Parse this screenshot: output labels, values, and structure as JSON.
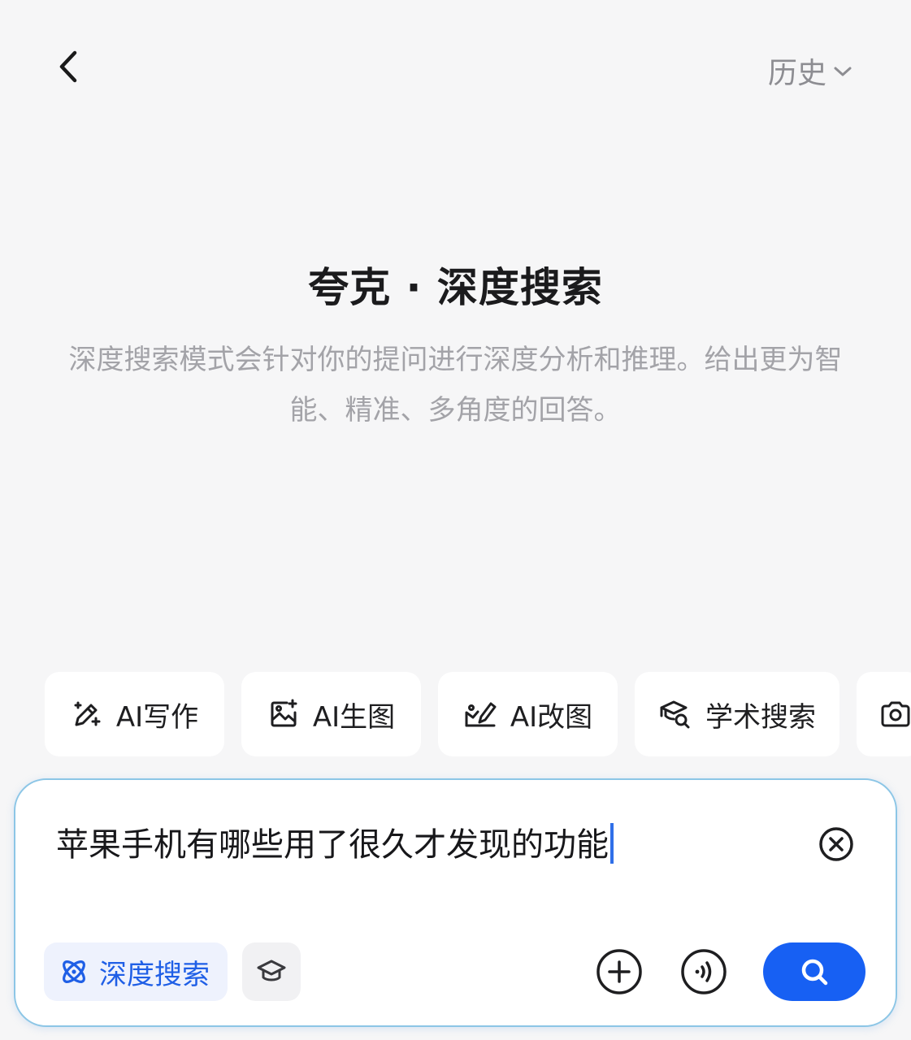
{
  "header": {
    "back_icon": "chevron-left-icon",
    "history_label": "历史",
    "history_icon": "chevron-down-icon"
  },
  "hero": {
    "title": "夸克 · 深度搜索",
    "description": "深度搜索模式会针对你的提问进行深度分析和推理。给出更为智能、精准、多角度的回答。"
  },
  "chips": [
    {
      "label": "AI写作",
      "icon": "magic-pen-icon"
    },
    {
      "label": "AI生图",
      "icon": "image-sparkle-icon"
    },
    {
      "label": "AI改图",
      "icon": "image-edit-icon"
    },
    {
      "label": "学术搜索",
      "icon": "scholar-search-icon"
    },
    {
      "label": "",
      "icon": "camera-icon"
    }
  ],
  "input": {
    "value": "苹果手机有哪些用了很久才发现的功能",
    "clear_icon": "clear-circle-icon"
  },
  "toolbar": {
    "deep_search_label": "深度搜索",
    "deep_search_icon": "atom-icon",
    "academic_icon": "graduation-cap-icon",
    "add_icon": "plus-circle-icon",
    "voice_icon": "voice-wave-icon",
    "search_icon": "search-icon"
  },
  "colors": {
    "accent": "#1760f3",
    "accent_text": "#1f5fe6",
    "muted_text": "#a3a3a8",
    "background": "#f6f6f7",
    "input_border": "#8cc6e6"
  }
}
